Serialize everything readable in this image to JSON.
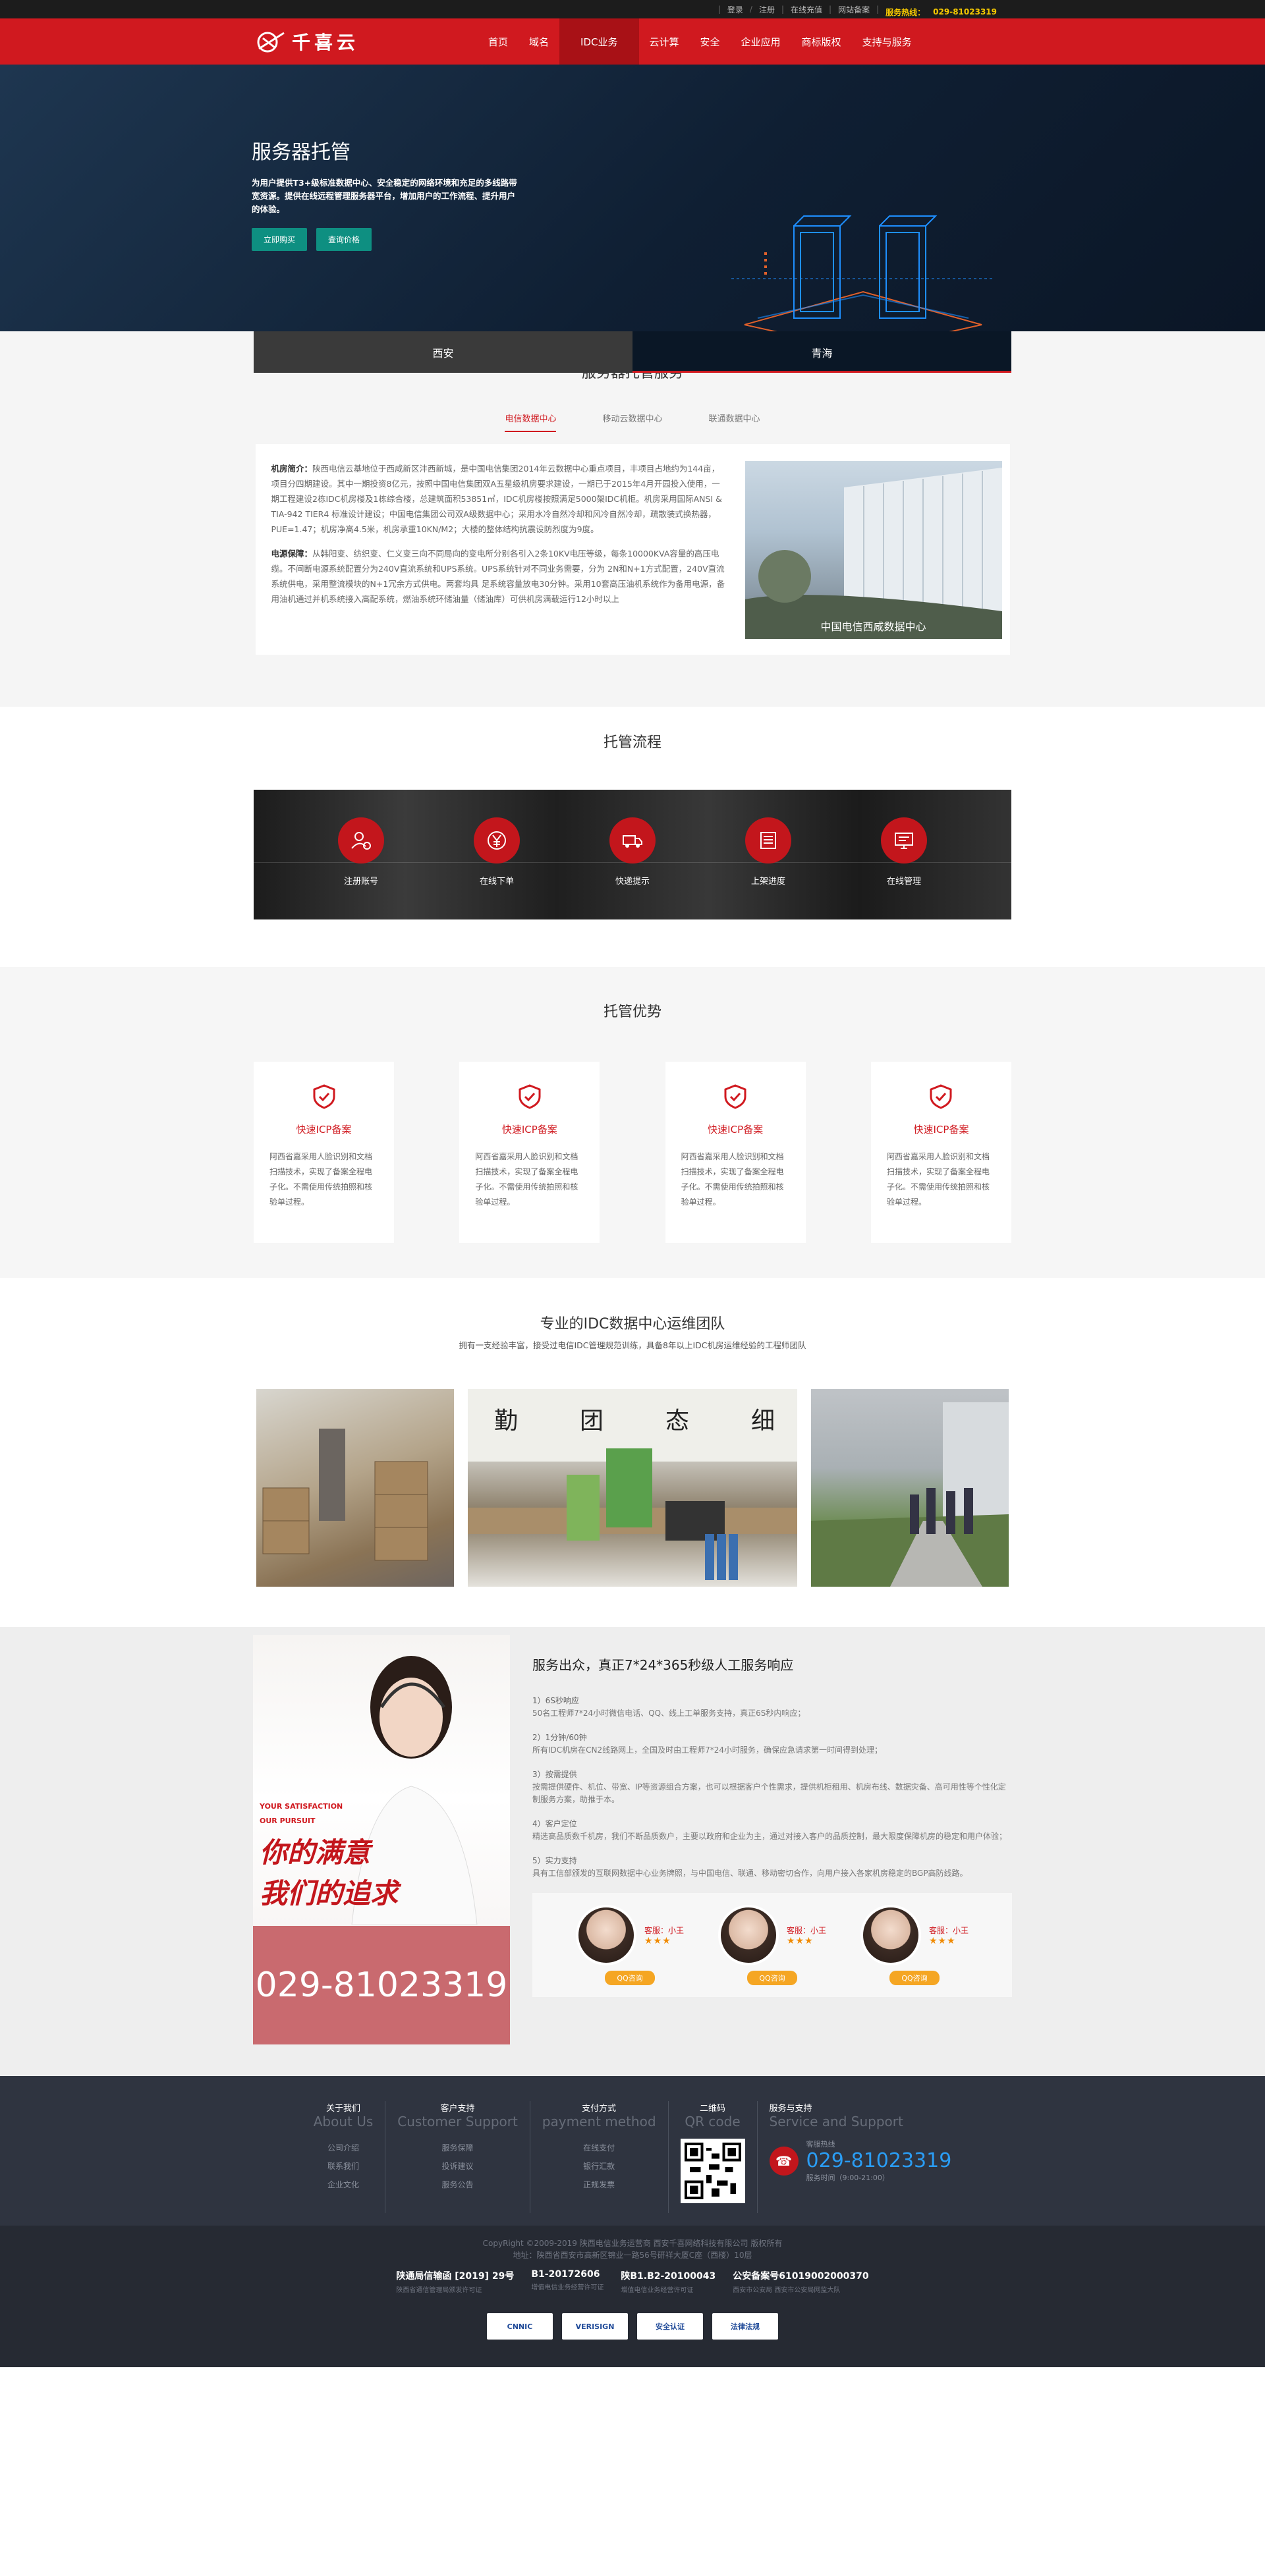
{
  "topbar": {
    "login": "登录",
    "register": "注册",
    "online": "在线充值",
    "beian": "网站备案",
    "hotline_label": "服务热线：",
    "hotline": "029-81023319"
  },
  "header": {
    "logo_text": "千喜云",
    "nav": [
      "首页",
      "域名",
      "IDC业务",
      "云计算",
      "安全",
      "企业应用",
      "商标版权",
      "支持与服务"
    ]
  },
  "banner": {
    "title": "服务器托管",
    "desc": "为用户提供T3+级标准数据中心、安全稳定的网络环境和充足的多线路带宽资源。提供在线远程管理服务器平台，增加用户的工作流程、提升用户的体验。",
    "btn_buy": "立即购买",
    "btn_price": "查询价格",
    "tab1": "西安",
    "tab2": "青海"
  },
  "s1": {
    "title": "服务器托管服务",
    "tabs": [
      "电信数据中心",
      "移动云数据中心",
      "联通数据中心"
    ],
    "p1_label": "机房简介：",
    "p1": "陕西电信云基地位于西咸新区沣西新城，是中国电信集团2014年云数据中心重点项目，丰项目占地约为144亩，项目分四期建设。其中一期投资8亿元，按照中国电信集团双A五星级机房要求建设，一期已于2015年4月开园投入使用，一期工程建设2栋IDC机房楼及1栋综合楼，总建筑面积53851㎡，IDC机房楼按照满足5000架IDC机柜。机房采用国际ANSI & TIA-942 TIER4 标准设计建设；中国电信集团公司双A级数据中心；采用水冷自然冷却和风冷自然冷却，疏散装式换热器，PUE=1.47；机房净高4.5米，机房承重10KN/M2；大楼的整体结构抗震设防烈度为9度。",
    "p2_label": "电源保障：",
    "p2": "从韩阳变、纺织变、仁义变三向不同局向的变电所分别各引入2条10KV电压等级，每条10000KVA容量的高压电缆。不间断电源系统配置分为240V直流系统和UPS系统。UPS系统针对不同业务需要，分为 2N和N+1方式配置，240V直流系统供电，采用整流模块的N+1冗余方式供电。两套均具 足系统容量放电30分钟。采用10套高压油机系统作为备用电源，备用油机通过并机系统接入高配系统，燃油系统环储油量（储油库）可供机房满载运行12小时以上",
    "photo_caption": "中国电信西咸数据中心"
  },
  "s2": {
    "title": "托管流程",
    "steps": [
      "注册账号",
      "在线下单",
      "快递提示",
      "上架进度",
      "在线管理"
    ]
  },
  "s3": {
    "title": "托管优势",
    "cards": [
      {
        "title": "快速ICP备案",
        "desc": "阿西省嘉采用人脸识别和文档扫描技术，实现了备案全程电子化。不需使用传统拍照和核验单过程。"
      },
      {
        "title": "快速ICP备案",
        "desc": "阿西省嘉采用人脸识别和文档扫描技术，实现了备案全程电子化。不需使用传统拍照和核验单过程。"
      },
      {
        "title": "快速ICP备案",
        "desc": "阿西省嘉采用人脸识别和文档扫描技术，实现了备案全程电子化。不需使用传统拍照和核验单过程。"
      },
      {
        "title": "快速ICP备案",
        "desc": "阿西省嘉采用人脸识别和文档扫描技术，实现了备案全程电子化。不需使用传统拍照和核验单过程。"
      }
    ]
  },
  "s4": {
    "title": "专业的IDC数据中心运维团队",
    "sub": "拥有一支经验丰富，接受过电信IDC管理规范训练，具备8年以上IDC机房运维经验的工程师团队"
  },
  "s5": {
    "en1": "YOUR SATISFACTION",
    "en2": "OUR PURSUIT",
    "cn1": "你的满意",
    "cn2": "我们的追求",
    "phone": "029-81023319",
    "title": "服务出众，真正7*24*365秒级人工服务响应",
    "items": [
      {
        "t": "1）6S秒响应",
        "d": "50名工程师7*24小时微信电话、QQ、线上工单服务支持，真正6S秒内响应；"
      },
      {
        "t": "2）1分钟/60钟",
        "d": "所有IDC机房在CN2线路网上，全国及时由工程师7*24小时服务，确保应急请求第一时间得到处理；"
      },
      {
        "t": "3）按需提供",
        "d": "按需提供硬件、机位、带宽、IP等资源组合方案，也可以根据客户个性需求，提供机柜租用、机房布线、数据灾备、高可用性等个性化定制服务方案，助推于本。"
      },
      {
        "t": "4）客户定位",
        "d": "精选高品质数千机房，我们不断品质数户，主要以政府和企业为主，通过对接入客户的品质控制，最大限度保障机房的稳定和用户体验；"
      },
      {
        "t": "5）实力支持",
        "d": "具有工信部颁发的互联网数据中心业务牌照，与中国电信、联通、移动密切合作，向用户接入各家机房稳定的BGP高防线路。"
      }
    ],
    "agents": [
      {
        "name": "客服：小王",
        "stars": "★★★",
        "btn": "QQ咨询"
      },
      {
        "name": "客服：小王",
        "stars": "★★★",
        "btn": "QQ咨询"
      },
      {
        "name": "客服：小王",
        "stars": "★★★",
        "btn": "QQ咨询"
      }
    ]
  },
  "footer": {
    "cols": [
      {
        "title": "关于我们",
        "en": "About Us",
        "links": [
          "公司介绍",
          "联系我们",
          "企业文化"
        ]
      },
      {
        "title": "客户支持",
        "en": "Customer Support",
        "links": [
          "服务保障",
          "投诉建议",
          "服务公告"
        ]
      },
      {
        "title": "支付方式",
        "en": "payment method",
        "links": [
          "在线支付",
          "银行汇款",
          "正规发票"
        ]
      },
      {
        "title": "二维码",
        "en": "QR code",
        "links": []
      },
      {
        "title": "服务与支持",
        "en": "Service and Support",
        "links": []
      }
    ],
    "hot_label": "客服热线",
    "hot_num": "029-81023319",
    "hot_time": "服务时间（9:00-21:00）",
    "copy1": "CopyRight ©2009-2019 陕西电信业务运营商 西安千喜网络科技有限公司 版权所有",
    "copy2": "地址：陕西省西安市高新区锦业一路56号研祥大厦C座（西楼）10层",
    "lic": [
      {
        "b": "陕通局信输函 [2019] 29号",
        "s": "陕西省通信管理局颁发许可证"
      },
      {
        "b": "B1-20172606",
        "s": "增值电信业务经营许可证"
      },
      {
        "b": "陕B1.B2-20100043",
        "s": "增值电信业务经营许可证"
      },
      {
        "b": "公安备案号61019002000370",
        "s": "西安市公安局 西安市公安局网监大队"
      }
    ],
    "badges": [
      "CNNIC",
      "VERISIGN",
      "安全认证",
      "法律法规"
    ]
  }
}
